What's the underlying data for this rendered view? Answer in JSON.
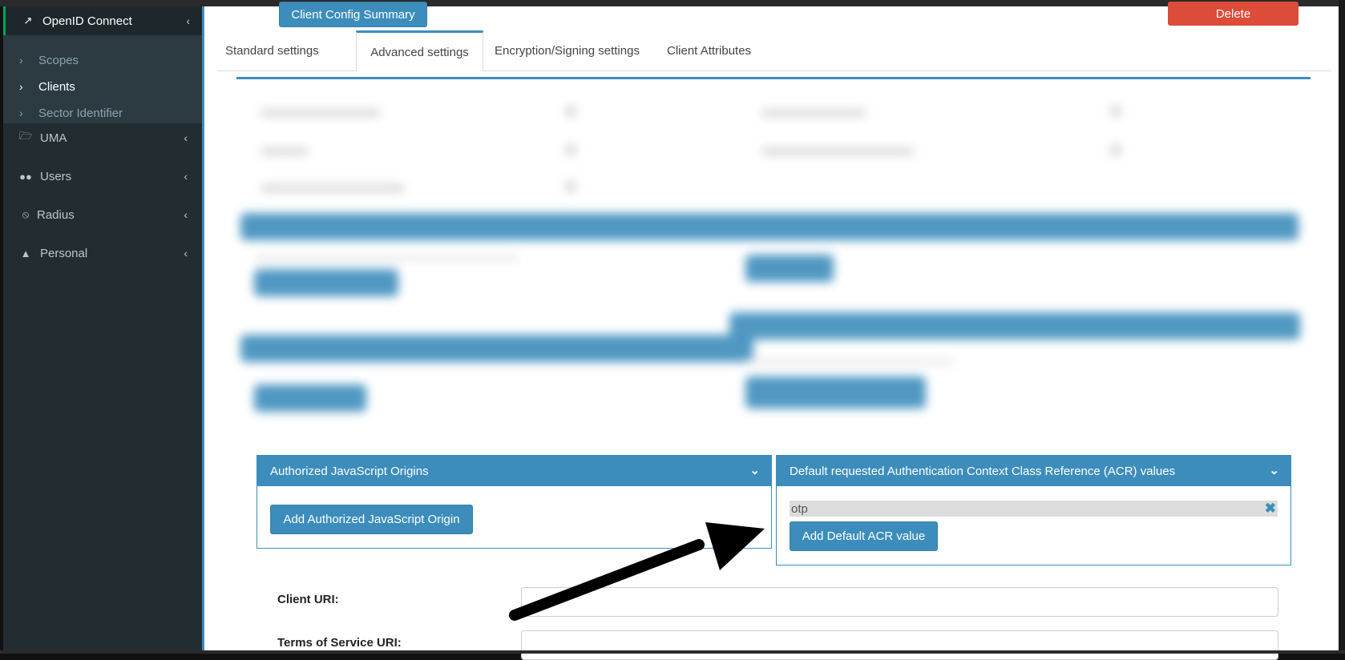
{
  "sidebar": {
    "openid": {
      "label": "OpenID Connect",
      "icon": "external-link-icon"
    },
    "subitems": [
      {
        "label": "Scopes"
      },
      {
        "label": "Clients"
      },
      {
        "label": "Sector Identifier"
      }
    ],
    "items": [
      {
        "label": "UMA",
        "icon": "folder-open-icon"
      },
      {
        "label": "Users",
        "icon": "users-icon"
      },
      {
        "label": "Radius",
        "icon": "rss-icon"
      },
      {
        "label": "Personal",
        "icon": "user-icon"
      }
    ]
  },
  "header": {
    "summary_button": "Client Config Summary",
    "delete_button": "Delete"
  },
  "tabs": [
    {
      "label": "Standard settings"
    },
    {
      "label": "Advanced settings"
    },
    {
      "label": "Encryption/Signing settings"
    },
    {
      "label": "Client Attributes"
    }
  ],
  "js_origins": {
    "title": "Authorized JavaScript Origins",
    "add_button": "Add Authorized JavaScript Origin"
  },
  "acr": {
    "title": "Default requested Authentication Context Class Reference (ACR) values",
    "values": [
      "otp"
    ],
    "add_button": "Add Default ACR value"
  },
  "fields": {
    "client_uri_label": "Client URI:",
    "client_uri_value": "",
    "tos_uri_label": "Terms of Service URI:",
    "tos_uri_value": ""
  },
  "colors": {
    "primary": "#3c8dbc",
    "danger": "#dd4b39",
    "sidebar_bg": "#222d32",
    "active_accent": "#00a65a"
  }
}
